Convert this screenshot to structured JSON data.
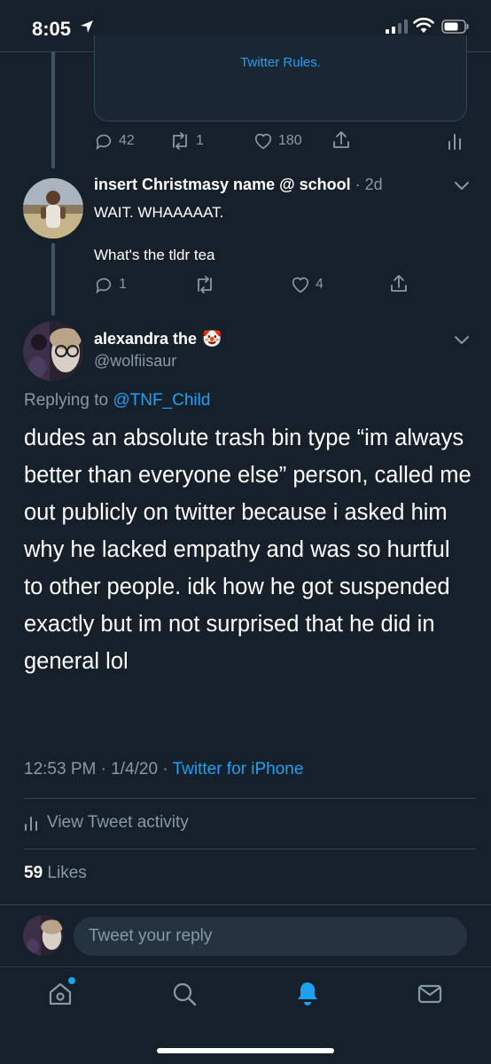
{
  "status_bar": {
    "time": "8:05"
  },
  "quoted": {
    "link_text": "Twitter Rules."
  },
  "parent_actions": {
    "replies": "42",
    "retweets": "1",
    "likes": "180"
  },
  "reply": {
    "name": "insert Christmasy name @ school",
    "time": "2d",
    "line1": "WAIT. WHAAAAAT.",
    "line2": "What's the tldr tea",
    "replies": "1",
    "likes": "4"
  },
  "main_tweet": {
    "name": "alexandra the",
    "name_emoji": "🤡",
    "handle": "@wolfiisaur",
    "replying_prefix": "Replying to",
    "replying_to": "@TNF_Child",
    "text": "dudes an absolute trash bin type “im always better than everyone else” person, called me out publicly on twitter because i asked him why he lacked empathy and was so hurtful to other people. idk how he got suspended exactly but im not surprised that he did in general lol",
    "time": "12:53 PM · 1/4/20 · ",
    "source": "Twitter for iPhone",
    "activity_label": "View Tweet activity",
    "likes_count": "59",
    "likes_label": "Likes"
  },
  "composer": {
    "placeholder": "Tweet your reply"
  },
  "tabs": [
    "home-icon",
    "search-icon",
    "notifications-icon",
    "messages-icon"
  ],
  "colors": {
    "background": "#15202b",
    "accent": "#1da1f2",
    "muted": "#8899a6",
    "border": "#38444d"
  }
}
